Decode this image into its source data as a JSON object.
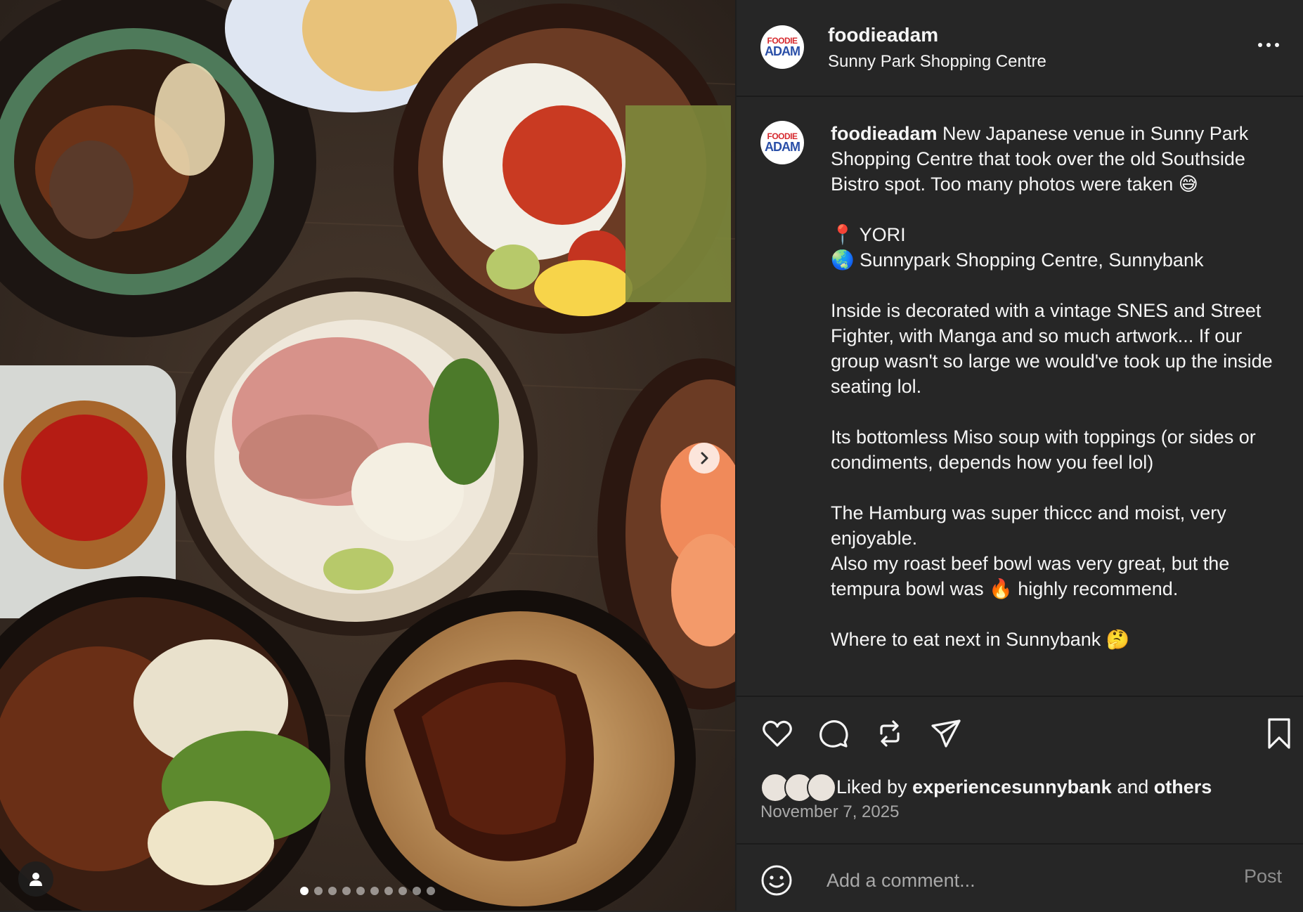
{
  "post": {
    "username": "foodieadam",
    "location": "Sunny Park Shopping Centre",
    "avatar_text": [
      "FOODIE",
      "ADAM"
    ]
  },
  "caption": {
    "username": "foodieadam",
    "intro": " New Japanese venue in Sunny Park Shopping Centre that took over the old Southside Bistro spot. Too many photos were taken 😅",
    "venue_line": "📍 YORI",
    "address_line": "🌏 Sunnypark Shopping Centre, Sunnybank",
    "para1": "Inside is decorated with a vintage SNES and Street Fighter, with Manga and so much artwork... If our group wasn't so large we would've took up the inside seating lol.",
    "para2": "Its bottomless Miso soup with toppings (or sides or condiments, depends how you feel lol)",
    "para3a": "The Hamburg was super thiccc and moist, very enjoyable.",
    "para3b": "Also my roast beef bowl was very great, but the tempura bowl was 🔥 highly recommend.",
    "para4": "Where to eat next in Sunnybank 🤔"
  },
  "actions": {
    "icons": [
      "heart-icon",
      "comment-icon",
      "repost-icon",
      "share-icon",
      "bookmark-icon"
    ]
  },
  "likes": {
    "prefix": "Liked by ",
    "user": "experiencesunnybank",
    "middle": " and ",
    "others": "others"
  },
  "date": "November 7, 2025",
  "comment": {
    "placeholder": "Add a comment...",
    "post_label": "Post"
  },
  "carousel": {
    "total": 10,
    "active": 1
  },
  "colors": {
    "panel_bg": "#262626",
    "text": "#f5f5f5",
    "muted": "#a8a8a8"
  }
}
